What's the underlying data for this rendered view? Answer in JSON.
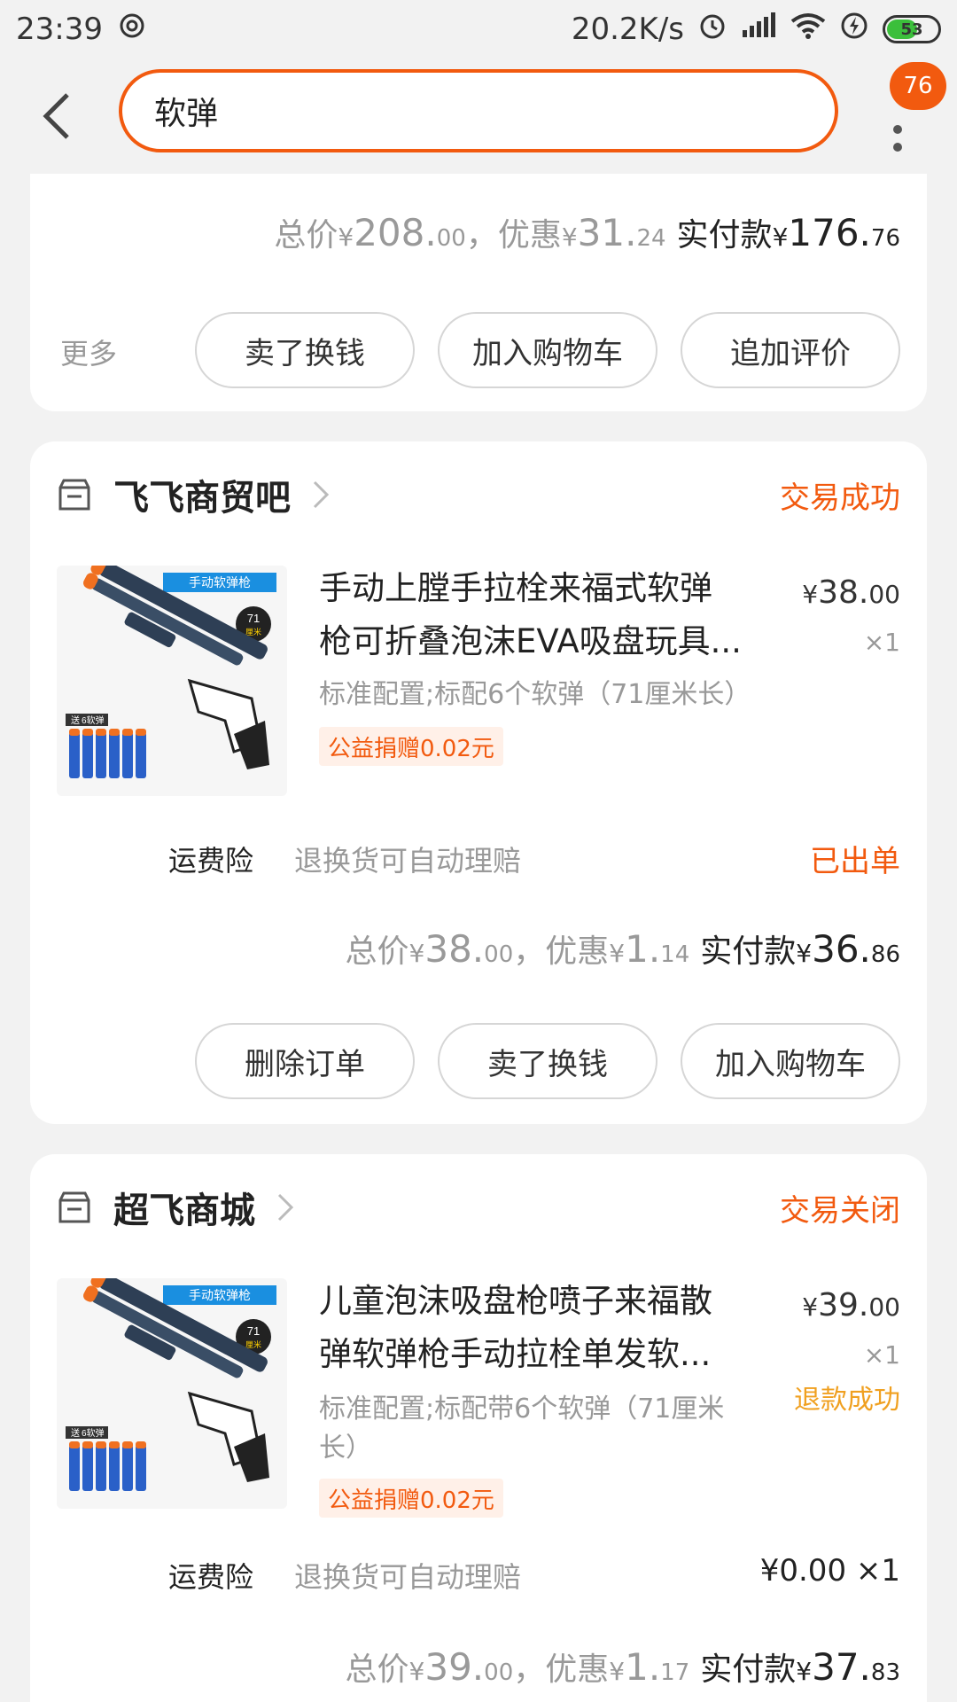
{
  "status_bar": {
    "time": "23:39",
    "speed": "20.2K/s",
    "battery": "53"
  },
  "header": {
    "search_value": "软弹",
    "badge": "76"
  },
  "order1": {
    "total_label": "总价",
    "total_int": "208.",
    "total_dec": "00",
    "discount_label": "，优惠",
    "discount_int": "31.",
    "discount_dec": "24",
    "pay_label": "实付款",
    "pay_int": "176.",
    "pay_dec": "76",
    "more_label": "更多",
    "actions": [
      "卖了换钱",
      "加入购物车",
      "追加评价"
    ]
  },
  "order2": {
    "shop": "飞飞商贸吧",
    "status": "交易成功",
    "title_line1": "手动上膛手拉栓来福式软弹",
    "title_line2": "枪可折叠泡沫EVA吸盘玩具...",
    "price_int": "38.",
    "price_dec": "00",
    "qty": "×1",
    "spec": "标准配置;标配6个软弹（71厘米长）",
    "tag": "公益捐赠0.02元",
    "insurance_label": "运费险",
    "insurance_desc": "退换货可自动理赔",
    "insurance_status": "已出单",
    "total_label": "总价",
    "total_int": "38.",
    "total_dec": "00",
    "discount_label": "，优惠",
    "discount_int": "1.",
    "discount_dec": "14",
    "pay_label": "实付款",
    "pay_int": "36.",
    "pay_dec": "86",
    "actions": [
      "删除订单",
      "卖了换钱",
      "加入购物车"
    ]
  },
  "order3": {
    "shop": "超飞商城",
    "status": "交易关闭",
    "title_line1": "儿童泡沫吸盘枪喷子来福散",
    "title_line2": "弹软弹枪手动拉栓单发软...",
    "price_int": "39.",
    "price_dec": "00",
    "qty": "×1",
    "refund": "退款成功",
    "spec": "标准配置;标配带6个软弹（71厘米长）",
    "tag": "公益捐赠0.02元",
    "insurance_label": "运费险",
    "insurance_desc": "退换货可自动理赔",
    "insurance_price": "¥0.00 ×1",
    "total_label": "总价",
    "total_int": "39.",
    "total_dec": "00",
    "discount_label": "，优惠",
    "discount_int": "1.",
    "discount_dec": "17",
    "pay_label": "实付款",
    "pay_int": "37.",
    "pay_dec": "83"
  },
  "product_image": {
    "banner": "手动软弹枪",
    "size_badge_num": "71",
    "size_badge_unit": "厘米",
    "gift_label": "送",
    "gift_text": "6软弹"
  },
  "colors": {
    "accent": "#f25a0f",
    "refund": "#f0a020"
  }
}
